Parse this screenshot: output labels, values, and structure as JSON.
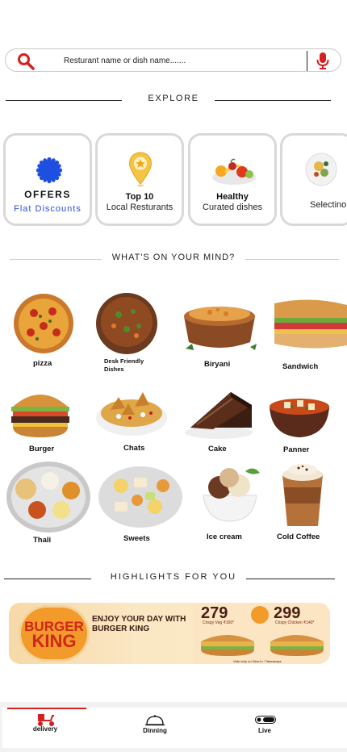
{
  "search": {
    "placeholder": "Resturant name or dish name.......",
    "icon": "search-icon",
    "mic_icon": "microphone-icon"
  },
  "explore": {
    "heading": "EXPLORE",
    "cards": [
      {
        "title": "OFFERS",
        "subtitle": "Flat Discounts",
        "icon": "badge-icon"
      },
      {
        "title": "Top 10",
        "subtitle": "Local Resturants",
        "icon": "location-pin-star-icon"
      },
      {
        "title": "Healthy",
        "subtitle": "Curated dishes",
        "icon": "fruit-bowl-icon"
      },
      {
        "title": "",
        "subtitle": "Selectino",
        "icon": "plate-icon"
      }
    ]
  },
  "mind": {
    "heading": "WHAT'S ON YOUR MIND?",
    "items": [
      {
        "label": "pizza"
      },
      {
        "label": "Desk Friendly Dishes"
      },
      {
        "label": "Biryani"
      },
      {
        "label": "Sandwich"
      },
      {
        "label": "Burger"
      },
      {
        "label": "Chats"
      },
      {
        "label": "Cake"
      },
      {
        "label": "Panner"
      },
      {
        "label": "Thali"
      },
      {
        "label": "Sweets"
      },
      {
        "label": "Ice cream"
      },
      {
        "label": "Cold Coffee"
      }
    ]
  },
  "highlights": {
    "heading": "HIGHLIGHTS FOR YOU",
    "banner": {
      "brand": "BURGER KING",
      "brand_line1": "BURGER",
      "brand_line2": "KING",
      "tagline_line1": "ENJOY YOUR DAY WITH",
      "tagline_line2": "BURGER KING",
      "offer1_price": "79",
      "offer1_for": "2 For",
      "offer1_old": "₹100*",
      "offer1_item": "Crispy Veg",
      "offer2_price": "99",
      "offer2_for": "2 For",
      "offer2_old": "₹140*",
      "offer2_item": "Crispy Chicken",
      "fineprint": "Valid only on Dine-In / Takeaways"
    }
  },
  "bottom_nav": {
    "tabs": [
      {
        "label": "delivery",
        "icon": "scooter-icon",
        "active": true
      },
      {
        "label": "Dinning",
        "icon": "cloche-icon",
        "active": false
      },
      {
        "label": "Live",
        "icon": "live-icon",
        "active": false
      }
    ],
    "active_color": "#d32020"
  }
}
